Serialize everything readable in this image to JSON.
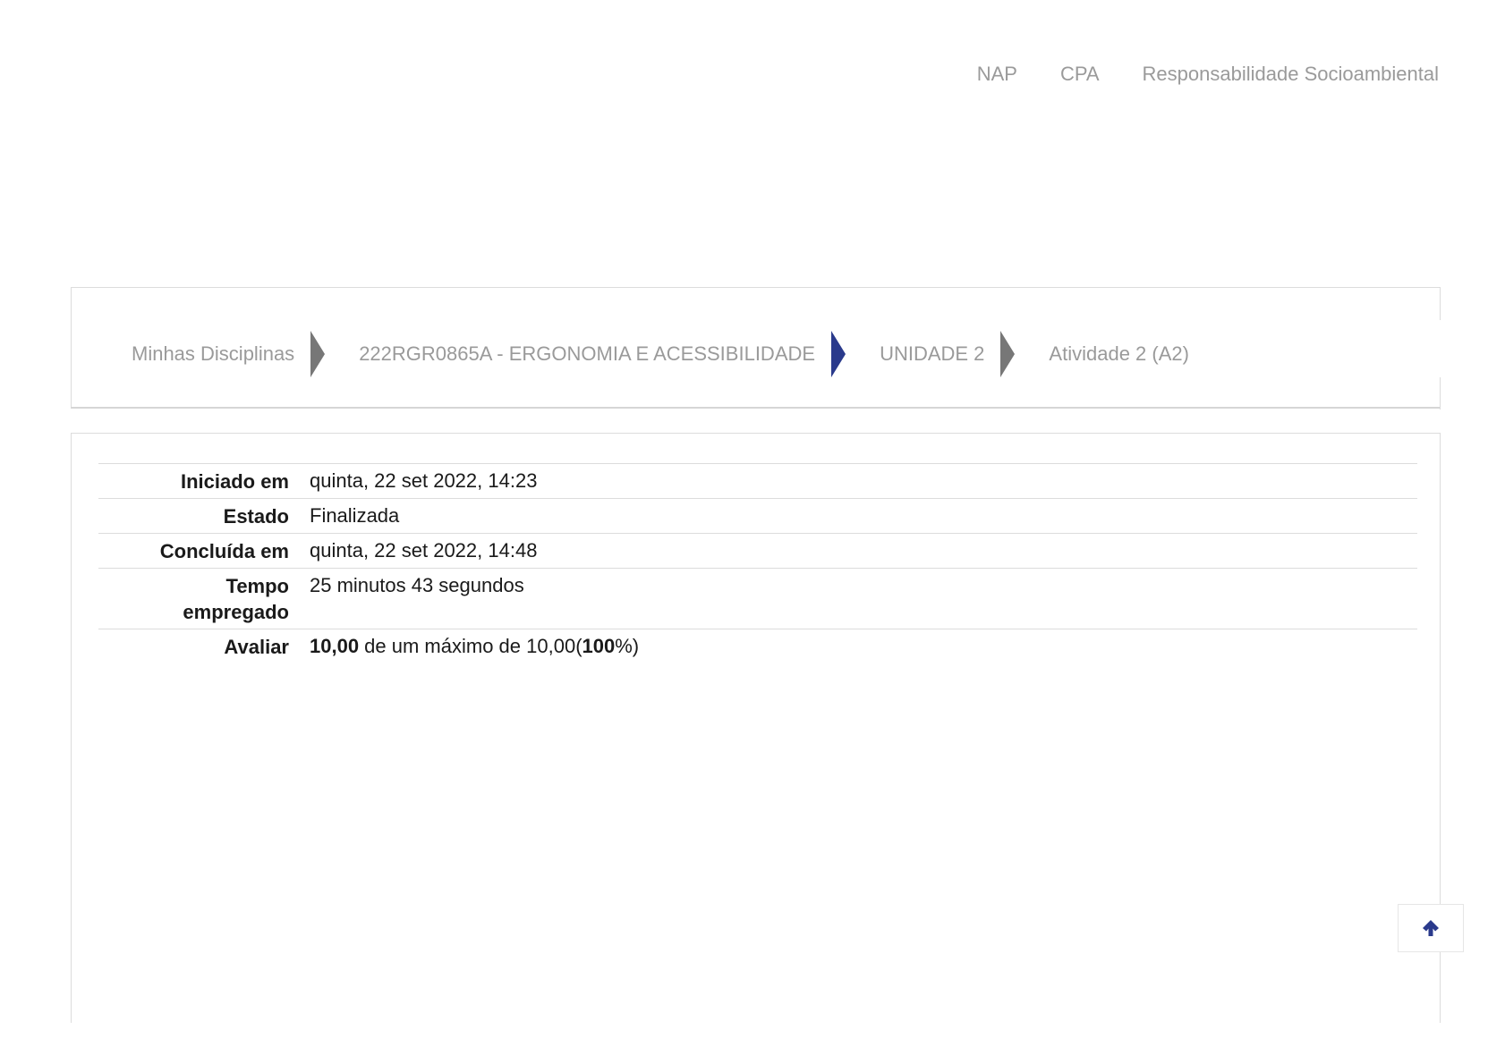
{
  "top_nav": {
    "items": [
      "NAP",
      "CPA",
      "Responsabilidade Socioambiental"
    ]
  },
  "breadcrumb": {
    "items": [
      "Minhas Disciplinas",
      "222RGR0865A - ERGONOMIA E ACESSIBILIDADE",
      "UNIDADE 2",
      "Atividade 2 (A2)"
    ]
  },
  "summary": {
    "started_label": "Iniciado em",
    "started_value": "quinta, 22 set 2022, 14:23",
    "state_label": "Estado",
    "state_value": "Finalizada",
    "completed_label": "Concluída em",
    "completed_value": "quinta, 22 set 2022, 14:48",
    "time_label": "Tempo empregado",
    "time_value": "25 minutos 43 segundos",
    "grade_label": "Avaliar",
    "grade_score": "10,00",
    "grade_text": " de um máximo de 10,00(",
    "grade_percent": "100",
    "grade_suffix": "%)"
  },
  "back_to_top": {
    "icon": "arrow-up-icon"
  },
  "colors": {
    "accent": "#2a3a8c",
    "separator_gray": "#777777",
    "muted_text": "#9a9a9a"
  }
}
